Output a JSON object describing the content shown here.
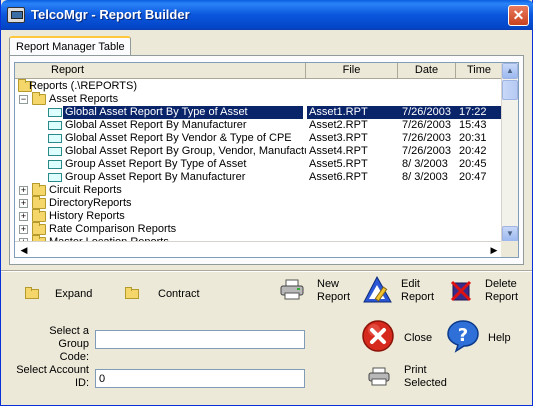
{
  "window": {
    "title": "TelcoMgr - Report Builder"
  },
  "tab": {
    "label": "Report Manager Table"
  },
  "table": {
    "headers": {
      "report": "Report",
      "file": "File",
      "date": "Date",
      "time": "Time"
    },
    "root": "Reports (.\\REPORTS)",
    "asset_folder": "Asset Reports",
    "rows": [
      {
        "report": "Global Asset Report By Type of Asset",
        "file": "Asset1.RPT",
        "date": "7/26/2003",
        "time": "17:22"
      },
      {
        "report": "Global Asset Report By Manufacturer",
        "file": "Asset2.RPT",
        "date": "7/26/2003",
        "time": "15:43"
      },
      {
        "report": "Global Asset Report By Vendor & Type of CPE",
        "file": "Asset3.RPT",
        "date": "7/26/2003",
        "time": "20:31"
      },
      {
        "report": "Global Asset Report By Group, Vendor, Manufacturer",
        "file": "Asset4.RPT",
        "date": "7/26/2003",
        "time": "20:42"
      },
      {
        "report": "Group Asset Report By Type of Asset",
        "file": "Asset5.RPT",
        "date": "8/ 3/2003",
        "time": "20:45"
      },
      {
        "report": "Group Asset Report By Manufacturer",
        "file": "Asset6.RPT",
        "date": "8/ 3/2003",
        "time": "20:47"
      }
    ],
    "folders": [
      "Circuit Reports",
      "DirectoryReports",
      "History Reports",
      "Rate Comparison Reports",
      "Master Location Reports"
    ]
  },
  "buttons": {
    "expand": "Expand",
    "contract": "Contract",
    "new_report_1": "New",
    "new_report_2": "Report",
    "edit_report_1": "Edit",
    "edit_report_2": "Report",
    "delete_report_1": "Delete",
    "delete_report_2": "Report",
    "close": "Close",
    "help": "Help",
    "print_1": "Print",
    "print_2": "Selected"
  },
  "form": {
    "group_label_1": "Select a Group",
    "group_label_2": "Code:",
    "group_value": "",
    "account_label_1": "Select Account",
    "account_label_2": "ID:",
    "account_value": "0"
  },
  "colors": {
    "title_bar": "#0a5ee0",
    "selection": "#0a246a",
    "window_bg": "#ece9d8"
  }
}
